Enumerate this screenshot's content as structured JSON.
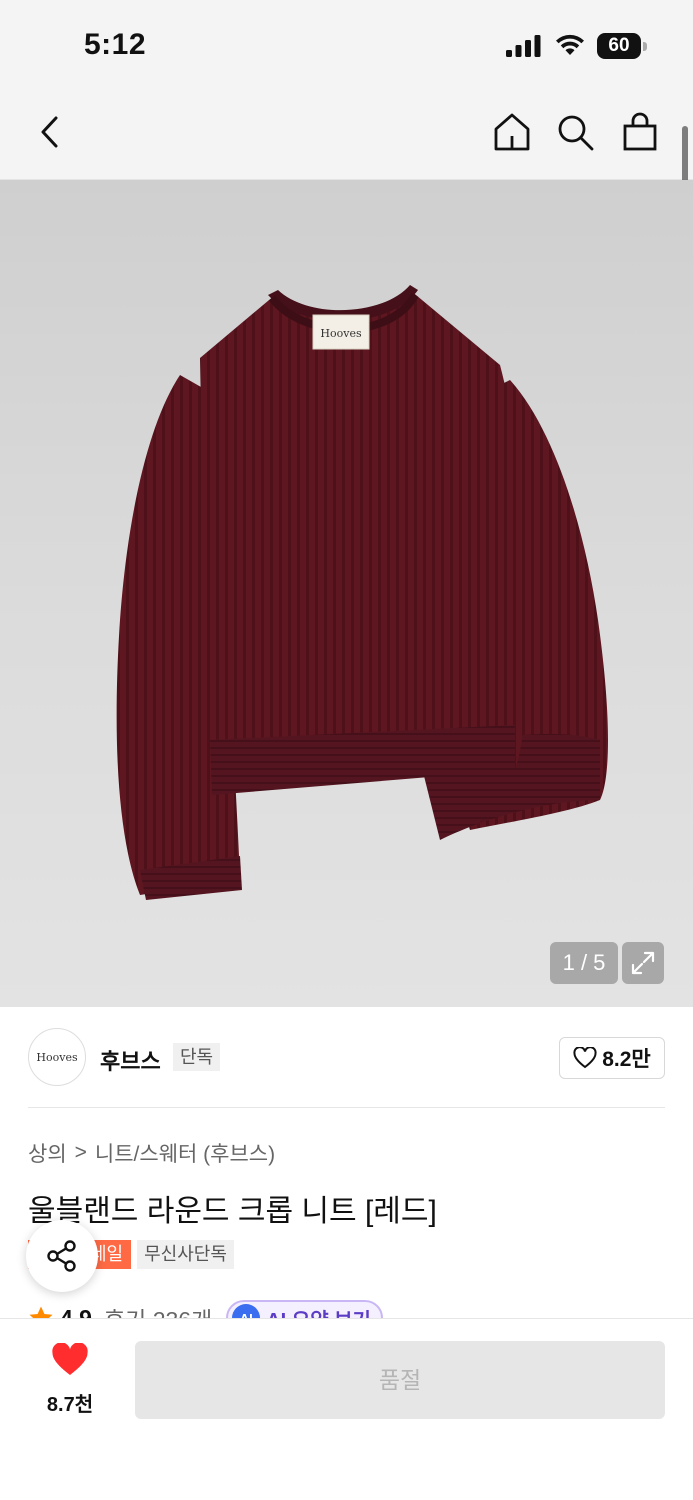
{
  "status_bar": {
    "time": "5:12",
    "battery": "60"
  },
  "hero": {
    "pager": "1 / 5",
    "label_text": "Hooves"
  },
  "brand": {
    "logo_text": "Hooves",
    "name": "후브스",
    "badge": "단독",
    "likes": "8.2만"
  },
  "breadcrumb": {
    "category": "상의",
    "separator": ">",
    "subcategory": "니트/스웨터 (후브스)"
  },
  "product": {
    "title": "울블랜드 라운드 크롭 니트 [레드]",
    "tag_sale": "세일",
    "tag_exclusive": "무신사단독",
    "rating": "4.9",
    "reviews": "후기 236개",
    "ai_badge": "AI",
    "ai_summary": "AI 요약 보기"
  },
  "bottom": {
    "wish_count": "8.7천",
    "soldout_label": "품절"
  },
  "colors": {
    "accent_sale": "#ff6a45",
    "heart": "#ff2d2d",
    "sweater": "#5e1620",
    "ai": "#5b3cc4"
  }
}
